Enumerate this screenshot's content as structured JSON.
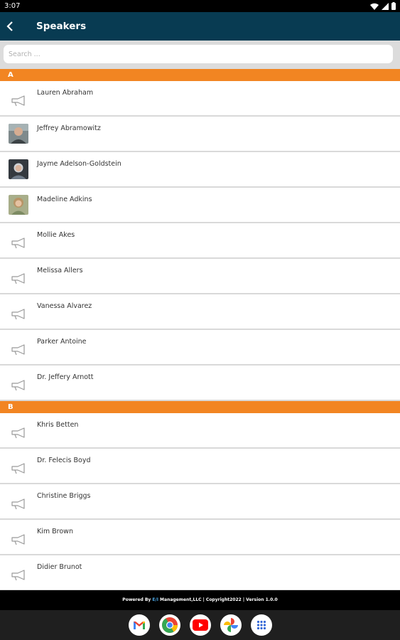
{
  "status_bar": {
    "time": "3:07"
  },
  "app_bar": {
    "title": "Speakers"
  },
  "search": {
    "placeholder": "Search ..."
  },
  "sections": [
    {
      "letter": "A",
      "speakers": [
        {
          "name": "Lauren Abraham",
          "icon": "megaphone-icon"
        },
        {
          "name": "Jeffrey Abramowitz",
          "icon": "avatar-photo"
        },
        {
          "name": "Jayme Adelson-Goldstein",
          "icon": "avatar-photo"
        },
        {
          "name": "Madeline Adkins",
          "icon": "avatar-photo"
        },
        {
          "name": "Mollie Akes",
          "icon": "megaphone-icon"
        },
        {
          "name": "Melissa Allers",
          "icon": "megaphone-icon"
        },
        {
          "name": "Vanessa Alvarez",
          "icon": "megaphone-icon"
        },
        {
          "name": "Parker Antoine",
          "icon": "megaphone-icon"
        },
        {
          "name": "Dr. Jeffery Arnott",
          "icon": "megaphone-icon"
        }
      ]
    },
    {
      "letter": "B",
      "speakers": [
        {
          "name": "Khris Betten",
          "icon": "megaphone-icon"
        },
        {
          "name": "Dr. Felecis Boyd",
          "icon": "megaphone-icon"
        },
        {
          "name": "Christine Briggs",
          "icon": "megaphone-icon"
        },
        {
          "name": "Kim Brown",
          "icon": "megaphone-icon"
        },
        {
          "name": "Didier Brunot",
          "icon": "megaphone-icon"
        }
      ]
    }
  ],
  "footer": {
    "prefix": "Powered By",
    "brand": "E/I",
    "suffix": "Management,LLC | Copyright2022 | Version 1.0.0"
  },
  "dock_apps": [
    "gmail-icon",
    "chrome-icon",
    "youtube-icon",
    "photos-icon",
    "app-drawer-icon"
  ],
  "colors": {
    "app_bar": "#083b52",
    "section_header": "#f28522",
    "search_background": "#dcdcdc"
  }
}
